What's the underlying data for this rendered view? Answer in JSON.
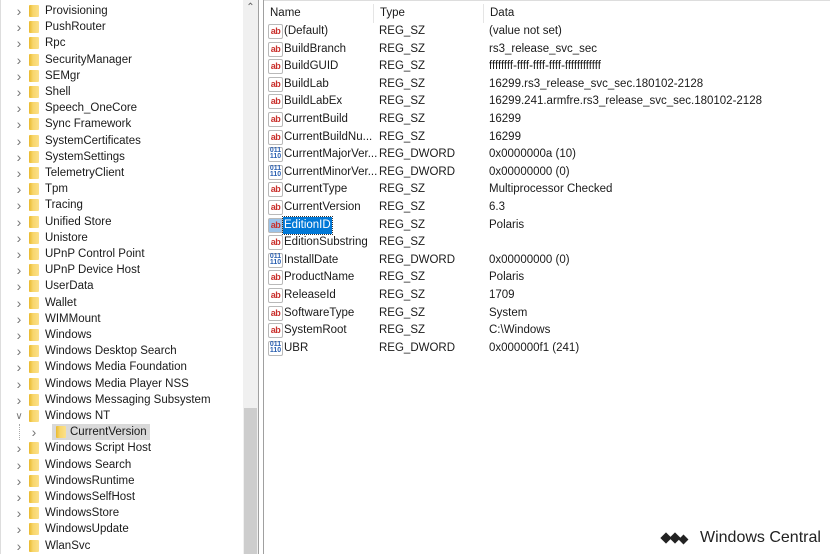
{
  "tree": {
    "items": [
      {
        "label": "Provisioning",
        "expanded": false
      },
      {
        "label": "PushRouter",
        "expanded": false
      },
      {
        "label": "Rpc",
        "expanded": false
      },
      {
        "label": "SecurityManager",
        "expanded": false
      },
      {
        "label": "SEMgr",
        "expanded": false
      },
      {
        "label": "Shell",
        "expanded": false
      },
      {
        "label": "Speech_OneCore",
        "expanded": false
      },
      {
        "label": "Sync Framework",
        "expanded": false
      },
      {
        "label": "SystemCertificates",
        "expanded": false
      },
      {
        "label": "SystemSettings",
        "expanded": false
      },
      {
        "label": "TelemetryClient",
        "expanded": false
      },
      {
        "label": "Tpm",
        "expanded": false
      },
      {
        "label": "Tracing",
        "expanded": false
      },
      {
        "label": "Unified Store",
        "expanded": false
      },
      {
        "label": "Unistore",
        "expanded": false
      },
      {
        "label": "UPnP Control Point",
        "expanded": false
      },
      {
        "label": "UPnP Device Host",
        "expanded": false
      },
      {
        "label": "UserData",
        "expanded": false
      },
      {
        "label": "Wallet",
        "expanded": false
      },
      {
        "label": "WIMMount",
        "expanded": false
      },
      {
        "label": "Windows",
        "expanded": false
      },
      {
        "label": "Windows Desktop Search",
        "expanded": false
      },
      {
        "label": "Windows Media Foundation",
        "expanded": false
      },
      {
        "label": "Windows Media Player NSS",
        "expanded": false
      },
      {
        "label": "Windows Messaging Subsystem",
        "expanded": false
      },
      {
        "label": "Windows NT",
        "expanded": true
      },
      {
        "label": "CurrentVersion",
        "expanded": false,
        "child": true,
        "selected": true
      },
      {
        "label": "Windows Script Host",
        "expanded": false
      },
      {
        "label": "Windows Search",
        "expanded": false
      },
      {
        "label": "WindowsRuntime",
        "expanded": false
      },
      {
        "label": "WindowsSelfHost",
        "expanded": false
      },
      {
        "label": "WindowsStore",
        "expanded": false
      },
      {
        "label": "WindowsUpdate",
        "expanded": false
      },
      {
        "label": "WlanSvc",
        "expanded": false
      }
    ]
  },
  "list": {
    "headers": {
      "name": "Name",
      "type": "Type",
      "data": "Data"
    },
    "rows": [
      {
        "name": "(Default)",
        "type": "REG_SZ",
        "data": "(value not set)"
      },
      {
        "name": "BuildBranch",
        "type": "REG_SZ",
        "data": "rs3_release_svc_sec"
      },
      {
        "name": "BuildGUID",
        "type": "REG_SZ",
        "data": "ffffffff-ffff-ffff-ffff-ffffffffffff"
      },
      {
        "name": "BuildLab",
        "type": "REG_SZ",
        "data": "16299.rs3_release_svc_sec.180102-2128"
      },
      {
        "name": "BuildLabEx",
        "type": "REG_SZ",
        "data": "16299.241.armfre.rs3_release_svc_sec.180102-2128"
      },
      {
        "name": "CurrentBuild",
        "type": "REG_SZ",
        "data": "16299"
      },
      {
        "name": "CurrentBuildNu...",
        "type": "REG_SZ",
        "data": "16299"
      },
      {
        "name": "CurrentMajorVer...",
        "type": "REG_DWORD",
        "data": "0x0000000a (10)"
      },
      {
        "name": "CurrentMinorVer...",
        "type": "REG_DWORD",
        "data": "0x00000000 (0)"
      },
      {
        "name": "CurrentType",
        "type": "REG_SZ",
        "data": "Multiprocessor Checked"
      },
      {
        "name": "CurrentVersion",
        "type": "REG_SZ",
        "data": "6.3"
      },
      {
        "name": "EditionID",
        "type": "REG_SZ",
        "data": "Polaris",
        "selected": true
      },
      {
        "name": "EditionSubstring",
        "type": "REG_SZ",
        "data": ""
      },
      {
        "name": "InstallDate",
        "type": "REG_DWORD",
        "data": "0x00000000 (0)"
      },
      {
        "name": "ProductName",
        "type": "REG_SZ",
        "data": "Polaris"
      },
      {
        "name": "ReleaseId",
        "type": "REG_SZ",
        "data": "1709"
      },
      {
        "name": "SoftwareType",
        "type": "REG_SZ",
        "data": "System"
      },
      {
        "name": "SystemRoot",
        "type": "REG_SZ",
        "data": "C:\\Windows"
      },
      {
        "name": "UBR",
        "type": "REG_DWORD",
        "data": "0x000000f1 (241)"
      }
    ],
    "icons": {
      "REG_SZ": "ab",
      "REG_DWORD": "011 110"
    }
  },
  "watermark": {
    "text": "Windows Central"
  }
}
